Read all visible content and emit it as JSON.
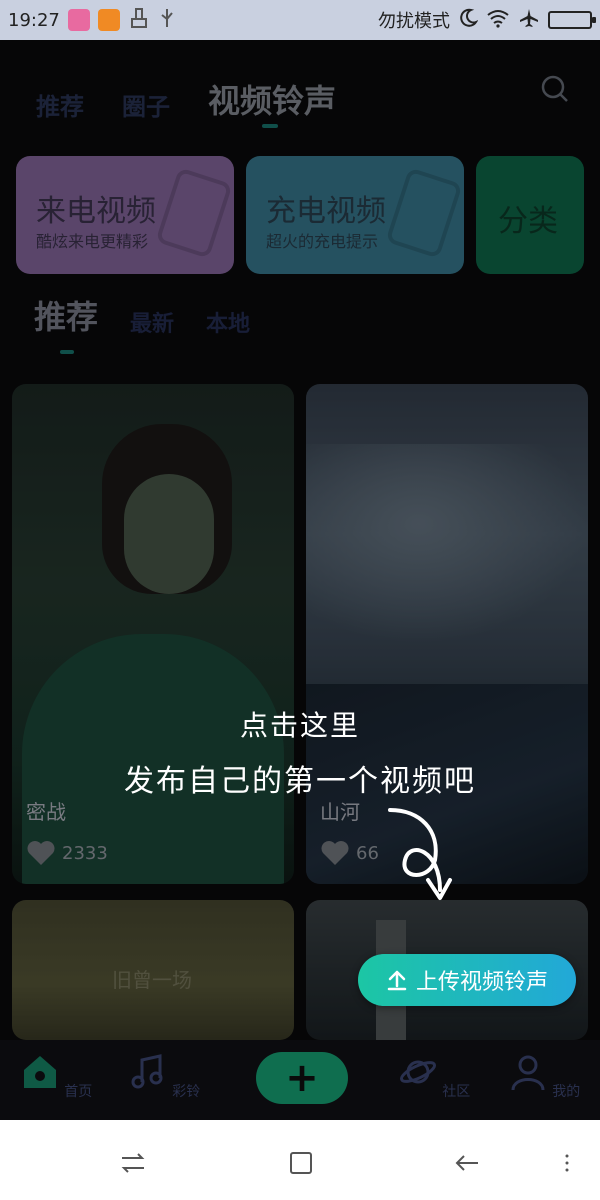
{
  "status_bar": {
    "time": "19:27",
    "dnd_label": "勿扰模式"
  },
  "top_nav": {
    "tabs": [
      {
        "label": "推荐"
      },
      {
        "label": "圈子"
      },
      {
        "label": "视频铃声",
        "active": true
      }
    ]
  },
  "categories": [
    {
      "title": "来电视频",
      "subtitle": "酷炫来电更精彩",
      "color": "#8b6aa3"
    },
    {
      "title": "充电视频",
      "subtitle": "超火的充电提示",
      "color": "#3a7d94"
    },
    {
      "title": "分类",
      "subtitle": "",
      "color": "#0e6a4a"
    }
  ],
  "sub_tabs": [
    {
      "label": "推荐",
      "active": true
    },
    {
      "label": "最新"
    },
    {
      "label": "本地"
    }
  ],
  "videos": [
    {
      "title": "密战",
      "likes": "2333"
    },
    {
      "title": "山河",
      "likes": "66"
    },
    {
      "title": "旧曾一场",
      "likes": ""
    },
    {
      "title": "",
      "likes": ""
    }
  ],
  "hint": {
    "line1": "点击这里",
    "line2": "发布自己的第一个视频吧"
  },
  "upload_button": {
    "label": "上传视频铃声"
  },
  "bottom_nav": {
    "items": [
      {
        "label": "首页"
      },
      {
        "label": "彩铃"
      },
      {
        "label": "社区"
      },
      {
        "label": "我的"
      }
    ]
  }
}
